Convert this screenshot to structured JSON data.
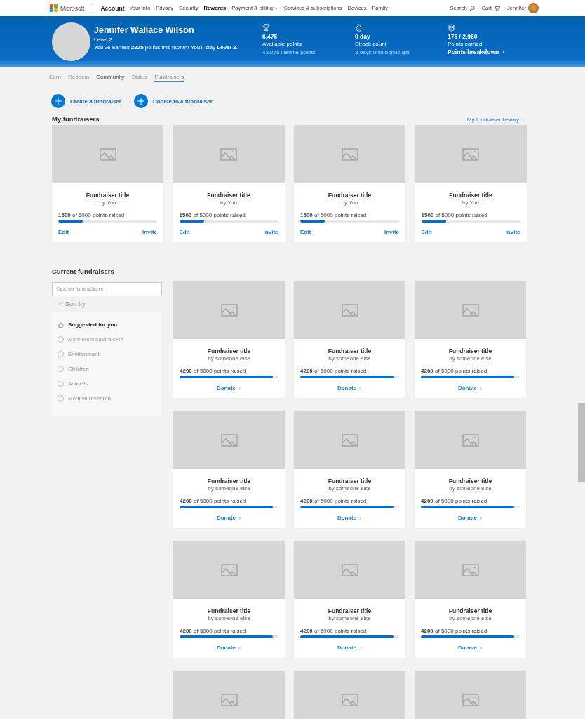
{
  "header": {
    "brand": "Microsoft",
    "section": "Account",
    "nav": [
      {
        "label": "Your info",
        "selected": false,
        "dropdown": false
      },
      {
        "label": "Privacy",
        "selected": false,
        "dropdown": false
      },
      {
        "label": "Security",
        "selected": false,
        "dropdown": false
      },
      {
        "label": "Rewards",
        "selected": true,
        "dropdown": false
      },
      {
        "label": "Payment & billing",
        "selected": false,
        "dropdown": true
      },
      {
        "label": "Services & subscriptions",
        "selected": false,
        "dropdown": false
      },
      {
        "label": "Devices",
        "selected": false,
        "dropdown": false
      },
      {
        "label": "Family",
        "selected": false,
        "dropdown": false
      }
    ],
    "search": "Search",
    "cart": "Cart",
    "user": "Jennifer"
  },
  "profile": {
    "name": "Jennifer Wallace Wilson",
    "level": "Level 2",
    "message": "You've earned **2825** points this month! You'll stay **Level 2**.",
    "stats": [
      {
        "kind": "trophy",
        "value": "6,475",
        "label": "Available points",
        "note": "43,075 lifetime points"
      },
      {
        "kind": "drop",
        "value": "0 day",
        "label": "Streak count",
        "note": "3 days until bonus gift"
      },
      {
        "kind": "coins",
        "value": "175 / 2,960",
        "label": "Points earned",
        "link": "Points breakdown"
      }
    ]
  },
  "tabs": [
    {
      "label": "Earn",
      "selected": false,
      "highlighted": false
    },
    {
      "label": "Redeem",
      "selected": false,
      "highlighted": false
    },
    {
      "label": "Community",
      "selected": false,
      "highlighted": true
    },
    {
      "label": "Status",
      "selected": false,
      "highlighted": false
    },
    {
      "label": "Fundraisers",
      "selected": true,
      "highlighted": false
    }
  ],
  "actions": [
    "Create a fundraiser",
    "Donate to a fundraiser"
  ],
  "my_fundraisers": {
    "heading": "My fundraisers",
    "history_link": "My fundraiser history",
    "cards": [
      {
        "kind": "own",
        "title": "Fundraiser title",
        "by": "by You",
        "progress": "**1500** of 5000 points raised",
        "level": 0.25,
        "links": [
          "Edit",
          "Invite"
        ]
      },
      {
        "kind": "own",
        "title": "Fundraiser title",
        "by": "by You",
        "progress": "**1500** of 5000 points raised",
        "level": 0.25,
        "links": [
          "Edit",
          "Invite"
        ]
      },
      {
        "kind": "own",
        "title": "Fundraiser title",
        "by": "by You",
        "progress": "**1500** of 5000 points raised",
        "level": 0.25,
        "links": [
          "Edit",
          "Invite"
        ]
      },
      {
        "kind": "own",
        "title": "Fundraiser title",
        "by": "by You",
        "progress": "**1500** of 5000 points raised",
        "level": 0.25,
        "links": [
          "Edit",
          "Invite"
        ]
      }
    ]
  },
  "current_fundraisers": {
    "heading": "Current fundraisers",
    "search_placeholder": "Search fundraisers",
    "sort_label": "Sort by",
    "filters": [
      {
        "kind": "suggested",
        "label": "Suggested for you",
        "selected": true
      },
      {
        "kind": "radio",
        "label": "My friends fundraisers",
        "selected": false
      },
      {
        "kind": "radio",
        "label": "Environment",
        "selected": false
      },
      {
        "kind": "radio",
        "label": "Children",
        "selected": false
      },
      {
        "kind": "radio",
        "label": "Animals",
        "selected": false
      },
      {
        "kind": "radio",
        "label": "Medical research",
        "selected": false
      }
    ],
    "cards": [
      {
        "kind": "other",
        "title": "Fundraiser title",
        "by": "by someone else",
        "progress": "**4200** of 5000 points raised",
        "level": 0.94,
        "button": "Donate"
      },
      {
        "kind": "other",
        "title": "Fundraiser title",
        "by": "by someone else",
        "progress": "**4200** of 5000 points raised",
        "level": 0.94,
        "button": "Donate"
      },
      {
        "kind": "other",
        "title": "Fundraiser title",
        "by": "by someone else",
        "progress": "**4200** of 5000 points raised",
        "level": 0.94,
        "button": "Donate"
      },
      {
        "kind": "other",
        "title": "Fundraiser title",
        "by": "by someone else",
        "progress": "**4200** of 5000 points raised",
        "level": 0.94,
        "button": "Donate"
      },
      {
        "kind": "other",
        "title": "Fundraiser title",
        "by": "by someone else",
        "progress": "**4200** of 5000 points raised",
        "level": 0.94,
        "button": "Donate"
      },
      {
        "kind": "other",
        "title": "Fundraiser title",
        "by": "by someone else",
        "progress": "**4200** of 5000 points raised",
        "level": 0.94,
        "button": "Donate"
      },
      {
        "kind": "other",
        "title": "Fundraiser title",
        "by": "by someone else",
        "progress": "**4200** of 5000 points raised",
        "level": 0.94,
        "button": "Donate"
      },
      {
        "kind": "other",
        "title": "Fundraiser title",
        "by": "by someone else",
        "progress": "**4200** of 5000 points raised",
        "level": 0.94,
        "button": "Donate"
      },
      {
        "kind": "other",
        "title": "Fundraiser title",
        "by": "by someone else",
        "progress": "**4200** of 5000 points raised",
        "level": 0.94,
        "button": "Donate"
      },
      {
        "kind": "image_only"
      },
      {
        "kind": "image_only"
      },
      {
        "kind": "image_only"
      }
    ]
  }
}
